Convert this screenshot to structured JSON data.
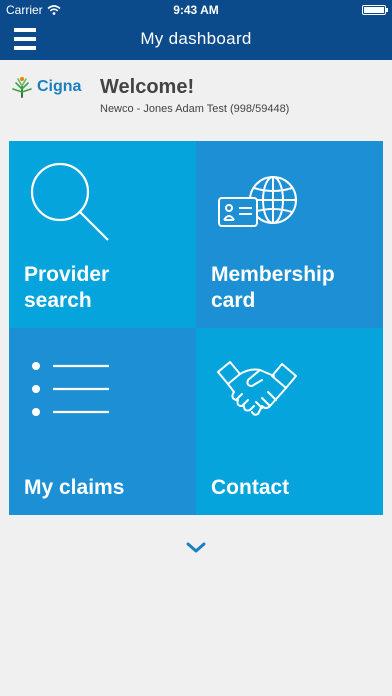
{
  "status_bar": {
    "carrier": "Carrier",
    "time": "9:43 AM"
  },
  "nav": {
    "title": "My dashboard"
  },
  "brand": {
    "name": "Cigna"
  },
  "welcome": {
    "title": "Welcome!",
    "subtitle": "Newco - Jones Adam Test (998/59448)"
  },
  "tiles": [
    {
      "label": "Provider\nsearch",
      "icon": "search-icon",
      "color": "#05a4dd"
    },
    {
      "label": "Membership\ncard",
      "icon": "id-card-globe-icon",
      "color": "#1d8fd5"
    },
    {
      "label": "My claims",
      "icon": "list-icon",
      "color": "#1d8fd5"
    },
    {
      "label": "Contact",
      "icon": "handshake-icon",
      "color": "#05a4dd"
    }
  ],
  "colors": {
    "header": "#0b4a8b",
    "background": "#f0f0f0",
    "accent": "#1a80c0",
    "text": "#444444"
  }
}
